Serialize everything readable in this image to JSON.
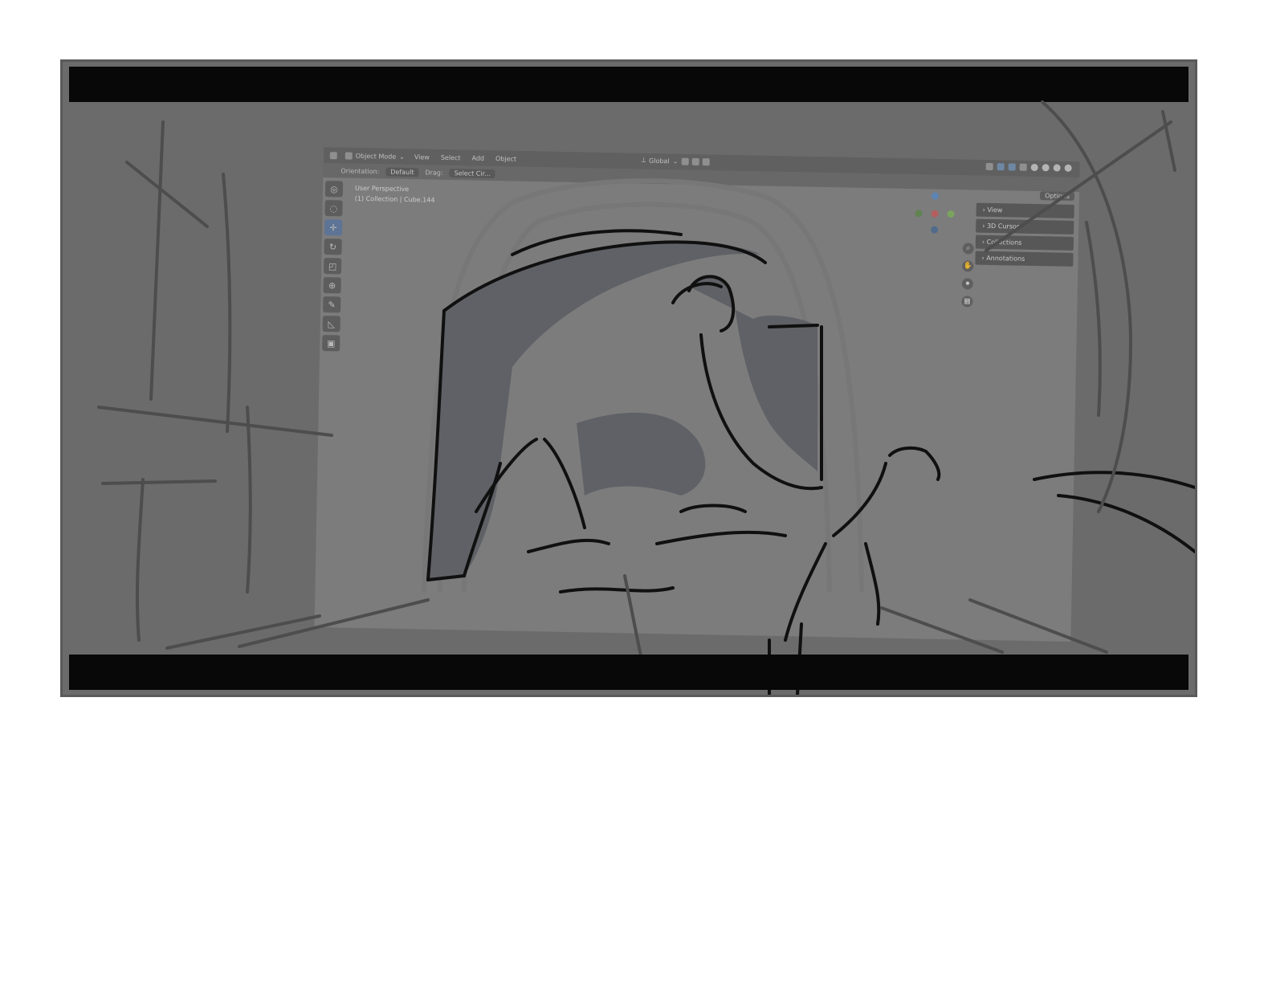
{
  "blender": {
    "header": {
      "mode": "Object Mode",
      "menus": [
        "View",
        "Select",
        "Add",
        "Object"
      ],
      "transform_orientation": "Global"
    },
    "subheader": {
      "orientation_label": "Orientation:",
      "orientation_value": "Default",
      "drag_label": "Drag:",
      "drag_value": "Select Cir..."
    },
    "viewport": {
      "perspective_label": "User Perspective",
      "collection_label": "(1) Collection | Cube.144"
    },
    "sidebar": {
      "options_label": "Options",
      "panels": [
        "View",
        "3D Cursor",
        "Collections",
        "Annotations"
      ]
    },
    "toolbar_icons": [
      "cursor-icon",
      "select-circle-icon",
      "move-icon",
      "rotate-icon",
      "scale-icon",
      "transform-icon",
      "annotate-icon",
      "measure-icon",
      "add-cube-icon"
    ]
  },
  "colors": {
    "frame_bg": "#6b6b6b",
    "letterbox": "#080808",
    "sketch_fill": "#5f6166",
    "sketch_line": "#101010",
    "accent": "#5a77a3"
  }
}
